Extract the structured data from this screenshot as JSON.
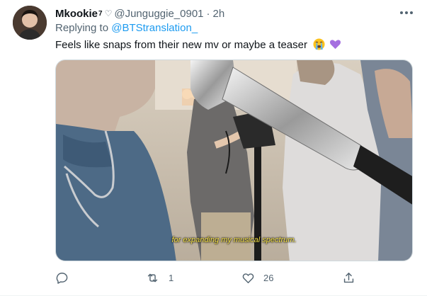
{
  "tweet": {
    "author_name": "Mkookie",
    "author_badge": "7",
    "author_heart": "♡",
    "handle": "@Junguggie_0901",
    "separator": "·",
    "time": "2h",
    "replying_prefix": "Replying to",
    "replying_to": "@BTStranslation_",
    "text": "Feels like snaps from their new mv or maybe a teaser",
    "emojis": [
      "loudly-crying-face",
      "purple-heart"
    ],
    "media": {
      "subtitle": "for expanding my musical spectrum."
    },
    "actions": {
      "reply_count": "",
      "retweet_count": "1",
      "like_count": "26",
      "share_count": ""
    }
  },
  "colors": {
    "link": "#1d9bf0",
    "text": "#0f1419",
    "muted": "#536471",
    "subtitle": "#f5e24a"
  }
}
